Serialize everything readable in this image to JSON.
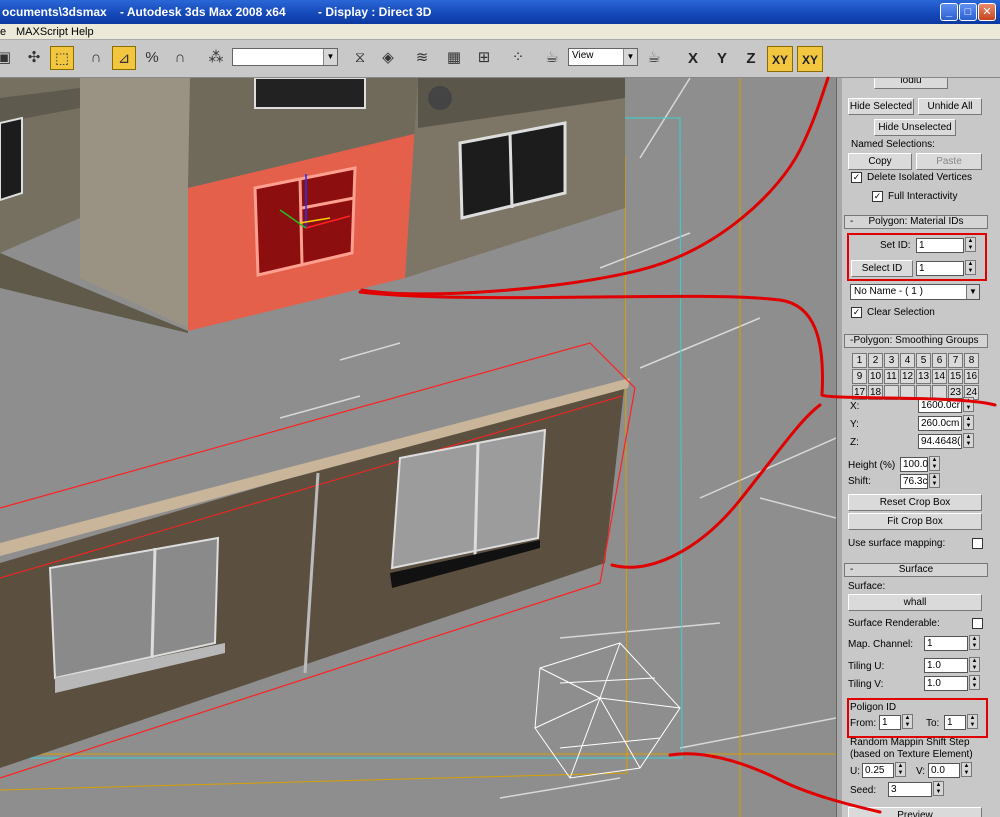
{
  "titlebar": {
    "path": "ocuments\\3dsmax",
    "app": "- Autodesk 3ds Max 2008 x64",
    "display": "- Display : Direct 3D",
    "min": "_",
    "max": "□",
    "close": "✕"
  },
  "menubar": {
    "items": [
      "e",
      "MAXScript",
      "Help"
    ]
  },
  "toolbar": {
    "view_dropdown": "View",
    "axes": [
      "X",
      "Y",
      "Z",
      "XY",
      "XY"
    ]
  },
  "panel": {
    "top_tab": "lodiu",
    "hide_selected": "Hide Selected",
    "unhide_all": "Unhide All",
    "hide_unselected": "Hide Unselected",
    "named_selections": "Named Selections:",
    "copy": "Copy",
    "paste": "Paste",
    "delete_isolated": "Delete Isolated Vertices",
    "full_interactivity": "Full Interactivity",
    "material_ids_title": "Polygon: Material IDs",
    "set_id_label": "Set ID:",
    "set_id_value": "1",
    "select_id_button": "Select ID",
    "select_id_value": "1",
    "material_name": "No Name - ( 1 )",
    "clear_selection": "Clear Selection",
    "smoothing_title": "Polygon: Smoothing Groups",
    "smoothing_row1": [
      "1",
      "2",
      "3",
      "4",
      "5",
      "6",
      "7",
      "8"
    ],
    "smoothing_row2": [
      "9",
      "10",
      "11",
      "12",
      "13",
      "14",
      "15",
      "16"
    ],
    "smoothing_row3": [
      "17",
      "18",
      "",
      "",
      "",
      "",
      "23",
      "24"
    ],
    "x_label": "X:",
    "x_value": "1600.0cr",
    "y_label": "Y:",
    "y_value": "260.0cm",
    "z_label": "Z:",
    "z_value": "94.4648(",
    "height_label": "Height (%)",
    "height_value": "100.0",
    "shift_label": "Shift:",
    "shift_value": "76.3c",
    "reset_crop": "Reset Crop Box",
    "fit_crop": "Fit Crop Box",
    "use_surface_mapping": "Use surface mapping:",
    "surface_title": "Surface",
    "surface_label": "Surface:",
    "surface_button": "whall",
    "surface_renderable": "Surface Renderable:",
    "map_channel_label": "Map. Channel:",
    "map_channel_value": "1",
    "tiling_u_label": "Tiling U:",
    "tiling_u_value": "1.0",
    "tiling_v_label": "Tiling V:",
    "tiling_v_value": "1.0",
    "poligon_id_label": "Poligon ID",
    "from_label": "From:",
    "from_value": "1",
    "to_label": "To:",
    "to_value": "1",
    "random_label": "Random Mappin Shift Step",
    "random_sub": "(based on Texture Element)",
    "u_label": "U:",
    "u_value": "0.25",
    "v_label": "V:",
    "v_value": "0.0",
    "seed_label": "Seed:",
    "seed_value": "3",
    "preview": "Preview"
  },
  "colors": {
    "titlebar": "#1447b8",
    "selected_face": "#e4604a",
    "annotation_red": "#e00000",
    "axis_active": "#f3c640"
  }
}
